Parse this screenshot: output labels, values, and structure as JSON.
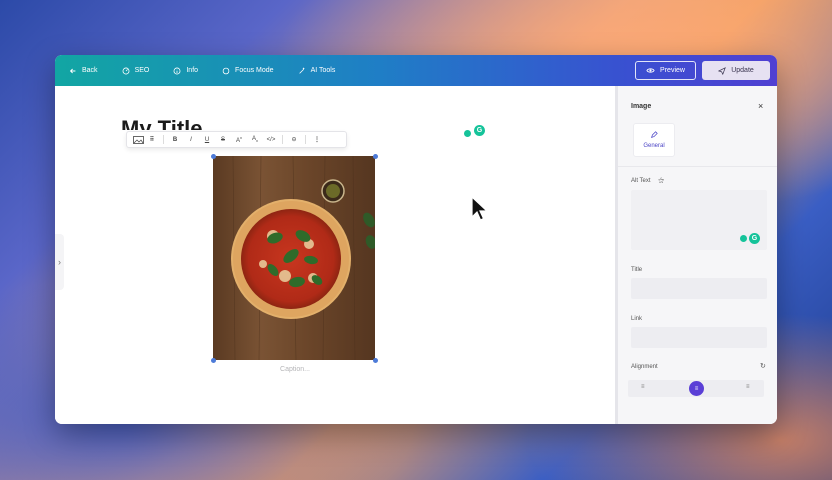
{
  "topbar": {
    "nav": [
      {
        "label": "Back",
        "icon": "arrow-left-icon"
      },
      {
        "label": "SEO",
        "icon": "gauge-icon"
      },
      {
        "label": "Info",
        "icon": "info-icon"
      },
      {
        "label": "Focus Mode",
        "icon": "focus-icon"
      },
      {
        "label": "AI Tools",
        "icon": "magic-wand-icon"
      }
    ],
    "preview_label": "Preview",
    "update_label": "Update"
  },
  "editor": {
    "title": "My Title",
    "caption_placeholder": "Caption...",
    "toolbar": {
      "items": [
        "B",
        "I",
        "U",
        "S",
        "A",
        "A",
        "</>",
        "link",
        "more"
      ]
    },
    "image_alt": "pizza on wooden board",
    "grammarly_letter": "G"
  },
  "panel": {
    "title": "Image",
    "close": "×",
    "tab_general": "General",
    "alt_text_label": "Alt Text",
    "title_label": "Title",
    "link_label": "Link",
    "alignment_label": "Alignment"
  },
  "colors": {
    "accent": "#5a3fd6",
    "topbar_start": "#12a6a3",
    "topbar_end": "#5040d2",
    "grammarly": "#15c39a"
  }
}
